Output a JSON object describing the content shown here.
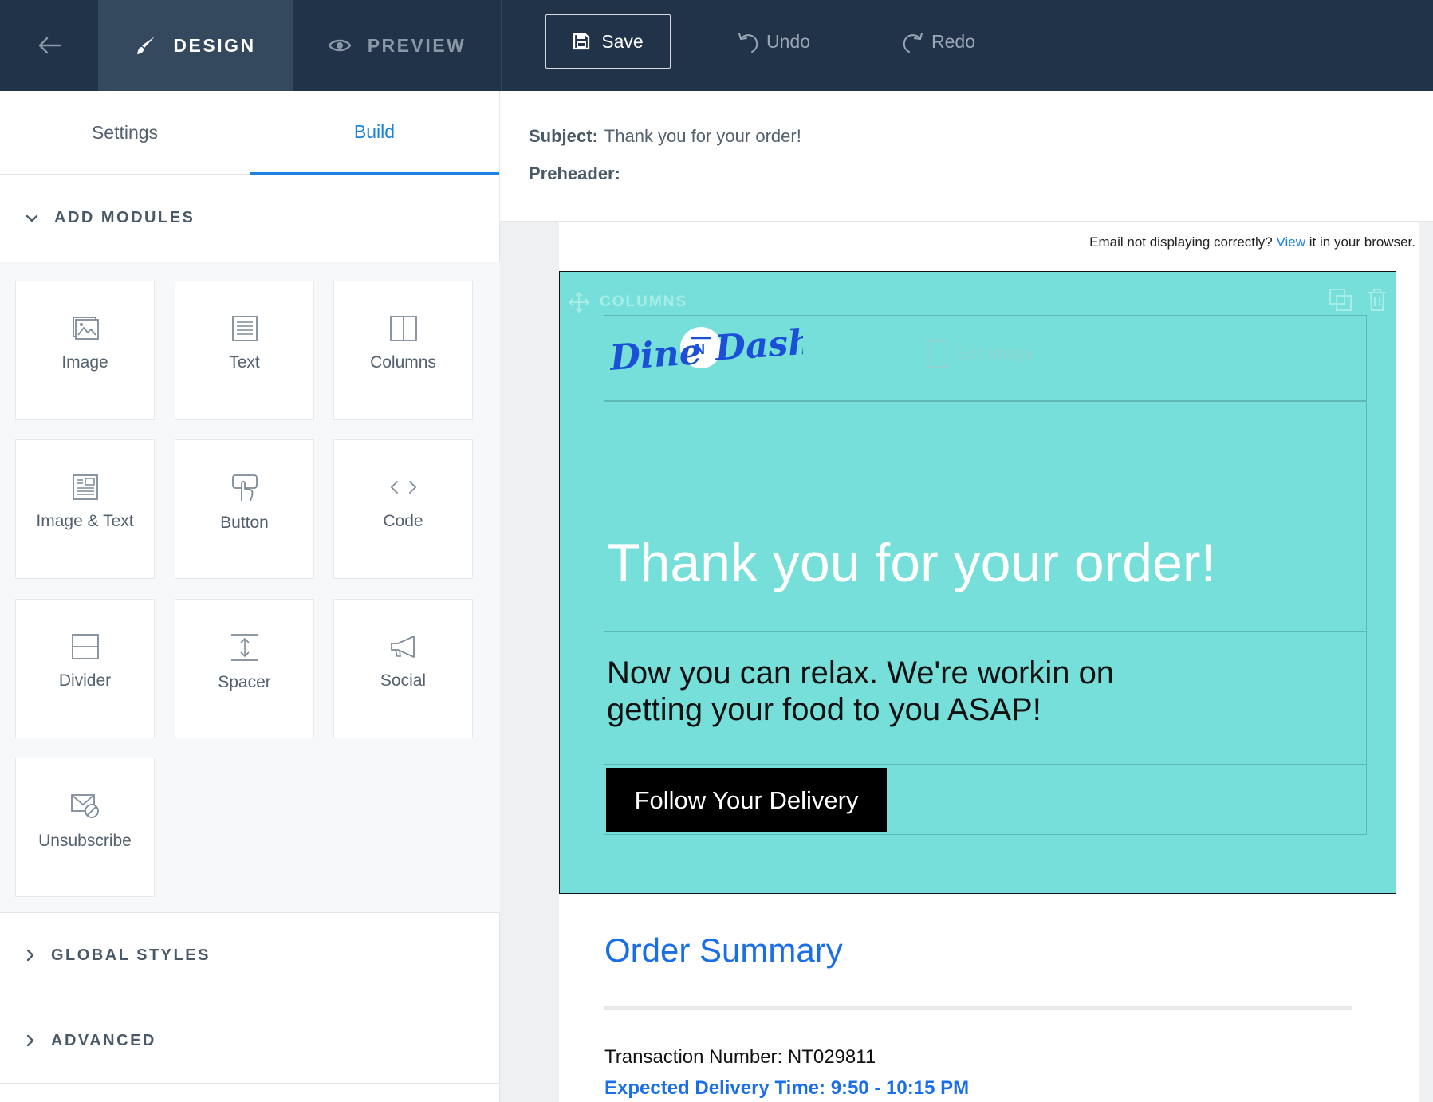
{
  "topbar": {
    "design_label": "DESIGN",
    "preview_label": "PREVIEW",
    "save_label": "Save",
    "undo_label": "Undo",
    "redo_label": "Redo"
  },
  "left_panel": {
    "tabs": {
      "settings": "Settings",
      "build": "Build"
    },
    "add_modules_title": "ADD MODULES",
    "modules": [
      {
        "label": "Image",
        "icon": "image-icon"
      },
      {
        "label": "Text",
        "icon": "text-icon"
      },
      {
        "label": "Columns",
        "icon": "columns-icon"
      },
      {
        "label": "Image & Text",
        "icon": "image-text-icon"
      },
      {
        "label": "Button",
        "icon": "button-icon"
      },
      {
        "label": "Code",
        "icon": "code-icon"
      },
      {
        "label": "Divider",
        "icon": "divider-icon"
      },
      {
        "label": "Spacer",
        "icon": "spacer-icon"
      },
      {
        "label": "Social",
        "icon": "megaphone-icon"
      },
      {
        "label": "Unsubscribe",
        "icon": "unsubscribe-icon"
      }
    ],
    "global_styles_title": "GLOBAL STYLES",
    "advanced_title": "ADVANCED"
  },
  "email_meta": {
    "subject_label": "Subject:",
    "subject_value": "Thank you for your order!",
    "preheader_label": "Preheader:"
  },
  "email": {
    "pre_note_before": "Email not displaying correctly?",
    "pre_note_link": "View",
    "pre_note_after": "it in your browser.",
    "columns_label": "COLUMNS",
    "logo_text": "Dine N Dash",
    "edit_image_label": "Edit Image",
    "hero_title": "Thank you for your order!",
    "hero_body": "Now you can relax. We're workin on getting your food to you ASAP!",
    "button_label": "Follow Your Delivery",
    "order_summary_title": "Order Summary",
    "transaction": "Transaction Number: NT029811",
    "expected_delivery": "Expected Delivery Time: 9:50 - 10:15 PM"
  },
  "colors": {
    "topbar": "#213349",
    "accent": "#1a82e2",
    "hero_bg": "#76dfd9",
    "order_blue": "#1a6fe8"
  }
}
